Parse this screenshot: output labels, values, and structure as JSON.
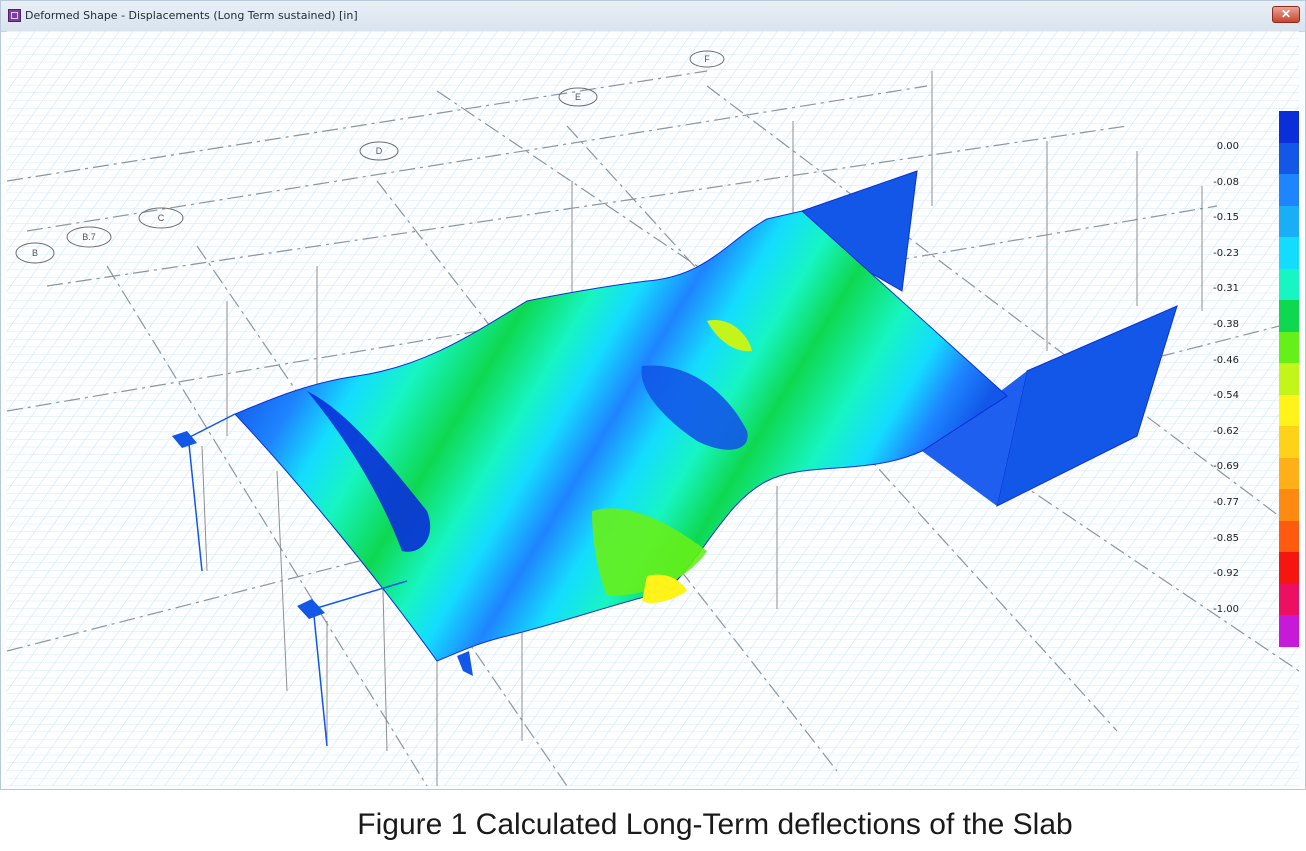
{
  "window": {
    "title": "Deformed Shape - Displacements (Long Term sustained)  [in]",
    "close_label": "✕"
  },
  "grid_bubbles": [
    "B",
    "B.7",
    "C",
    "D",
    "E",
    "F"
  ],
  "legend": {
    "colors": [
      "#0a2fd8",
      "#1257e8",
      "#1e84ff",
      "#19aef6",
      "#14dcff",
      "#17f5c2",
      "#0ed850",
      "#66f01a",
      "#c4f51a",
      "#fff31a",
      "#ffd21a",
      "#ffb018",
      "#ff8a12",
      "#ff5a0e",
      "#f5160f",
      "#ec0f62",
      "#c71ad9"
    ],
    "labels": [
      "0.00",
      "-0.08",
      "-0.15",
      "-0.23",
      "-0.31",
      "-0.38",
      "-0.46",
      "-0.54",
      "-0.62",
      "-0.69",
      "-0.77",
      "-0.85",
      "-0.92",
      "-1.00"
    ]
  },
  "caption": "Figure 1 Calculated Long-Term deflections of the Slab"
}
